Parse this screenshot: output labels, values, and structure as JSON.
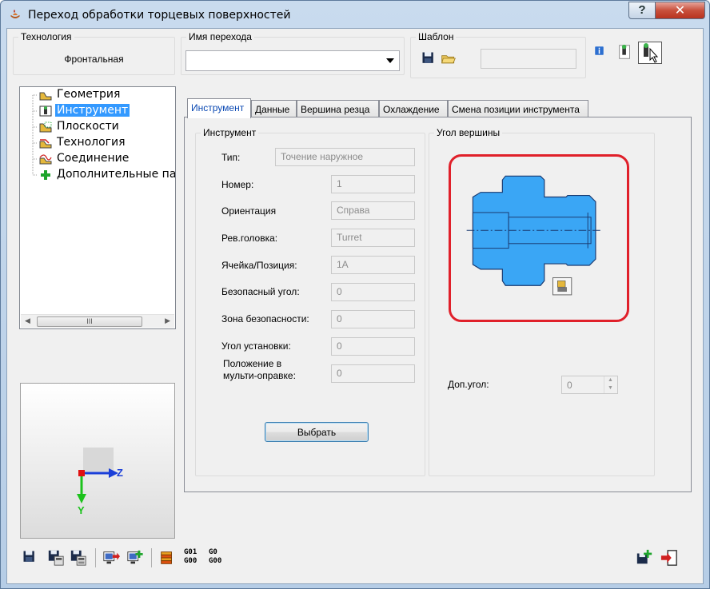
{
  "window": {
    "title": "Переход обработки торцевых поверхностей",
    "help_glyph": "?",
    "close_glyph": "✕"
  },
  "top": {
    "technology": {
      "title": "Технология",
      "value": "Фронтальная"
    },
    "transition_name": {
      "title": "Имя перехода",
      "value": ""
    },
    "template": {
      "title": "Шаблон",
      "value": ""
    }
  },
  "tree": {
    "items": [
      {
        "label": "Геометрия",
        "icon": "geometry-icon",
        "selected": false
      },
      {
        "label": "Инструмент",
        "icon": "tool-icon",
        "selected": true
      },
      {
        "label": "Плоскости",
        "icon": "planes-icon",
        "selected": false
      },
      {
        "label": "Технология",
        "icon": "technology-icon",
        "selected": false
      },
      {
        "label": "Соединение",
        "icon": "connection-icon",
        "selected": false
      },
      {
        "label": "Дополнительные пар",
        "icon": "plus-icon",
        "selected": false
      }
    ],
    "scroll_thumb_glyph": "III"
  },
  "axes": {
    "z_label": "Z",
    "y_label": "Y"
  },
  "tabs": [
    {
      "label": "Инструмент",
      "active": true
    },
    {
      "label": "Данные",
      "active": false
    },
    {
      "label": "Вершина резца",
      "active": false
    },
    {
      "label": "Охлаждение",
      "active": false
    },
    {
      "label": "Смена позиции инструмента",
      "active": false
    }
  ],
  "instrument": {
    "title": "Инструмент",
    "fields": [
      {
        "label": "Тип:",
        "value": "Точение наружное"
      },
      {
        "label": "Номер:",
        "value": "1"
      },
      {
        "label": "Ориентация",
        "value": "Справа"
      },
      {
        "label": "Рев.головка:",
        "value": "Turret"
      },
      {
        "label": "Ячейка/Позиция:",
        "value": "1A"
      },
      {
        "label": "Безопасный угол:",
        "value": "0"
      },
      {
        "label": "Зона безопасности:",
        "value": "0"
      },
      {
        "label": "Угол установки:",
        "value": "0"
      },
      {
        "label": "Положение в мульти-оправке:",
        "value": "0"
      }
    ],
    "select_button": "Выбрать"
  },
  "tip_angle": {
    "title": "Угол вершины",
    "extra_angle_label": "Доп.угол:",
    "extra_angle_value": "0"
  },
  "bottom_toolbar": {
    "gcode_a": "G01\nG00",
    "gcode_b": "G0\nG00"
  },
  "colors": {
    "part_fill": "#3aa6f5",
    "highlight_border": "#e0202a",
    "selection": "#3399ff"
  }
}
